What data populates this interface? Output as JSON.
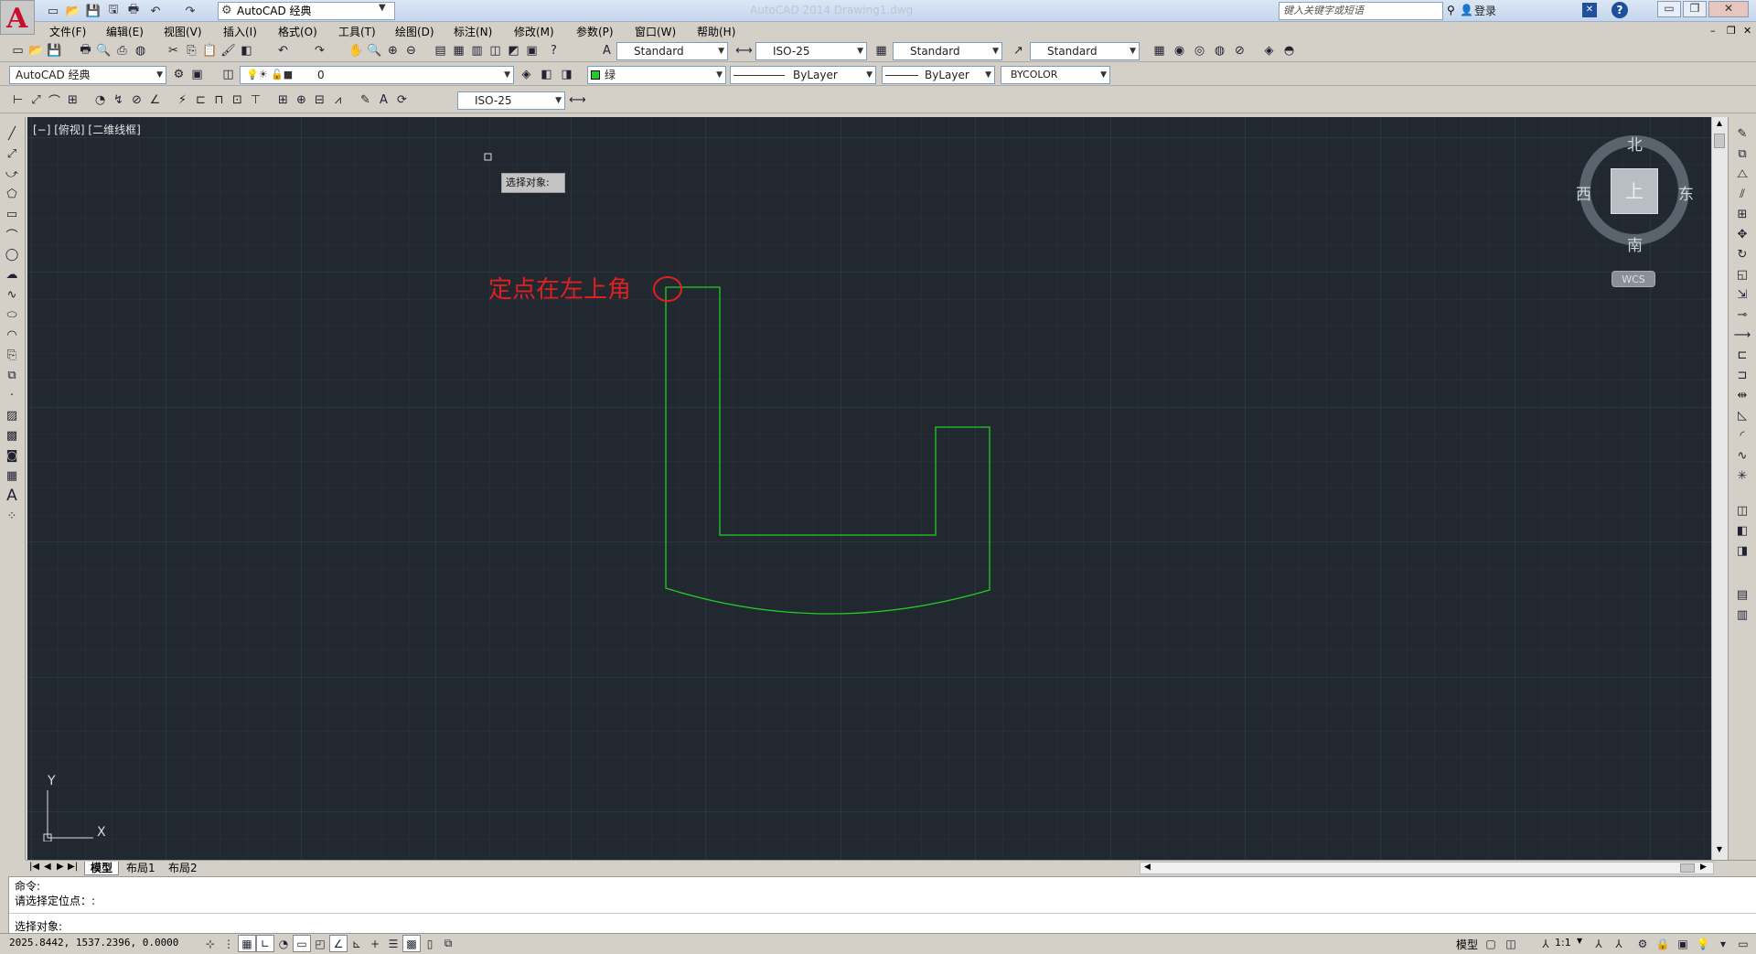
{
  "titlebar": {
    "workspace": "AutoCAD 经典",
    "title_text": "AutoCAD 2014    Drawing1.dwg",
    "search_placeholder": "键入关键字或短语",
    "login": "登录",
    "help": "?"
  },
  "menu": [
    "文件(F)",
    "编辑(E)",
    "视图(V)",
    "插入(I)",
    "格式(O)",
    "工具(T)",
    "绘图(D)",
    "标注(N)",
    "修改(M)",
    "参数(P)",
    "窗口(W)",
    "帮助(H)"
  ],
  "styles_toolbar": {
    "text_style": "Standard",
    "dim_style": "ISO-25",
    "table_style": "Standard",
    "mleader_style": "Standard"
  },
  "layers_toolbar": {
    "workspace": "AutoCAD 经典",
    "layer": "0",
    "color": "绿",
    "linetype": "ByLayer",
    "lineweight": "ByLayer",
    "plotstyle": "BYCOLOR"
  },
  "dim_toolbar": {
    "dim_style": "ISO-25"
  },
  "viewport": {
    "label": "[−] [俯视] [二维线框]",
    "tooltip": "选择对象:",
    "annotation": "定点在左上角",
    "annotation_color": "#e02020",
    "geometry_color": "#22cc22"
  },
  "viewcube": {
    "north": "北",
    "south": "南",
    "east": "东",
    "west": "西",
    "face": "上",
    "wcs": "WCS"
  },
  "ucs": {
    "x": "X",
    "y": "Y"
  },
  "tabs": [
    "模型",
    "布局1",
    "布局2"
  ],
  "command": {
    "line1": "命令:",
    "line2": "请选择定位点：:",
    "prompt": "选择对象:"
  },
  "status": {
    "coords": "2025.8442, 1537.2396, 0.0000",
    "model": "模型",
    "scale": "1:1"
  }
}
